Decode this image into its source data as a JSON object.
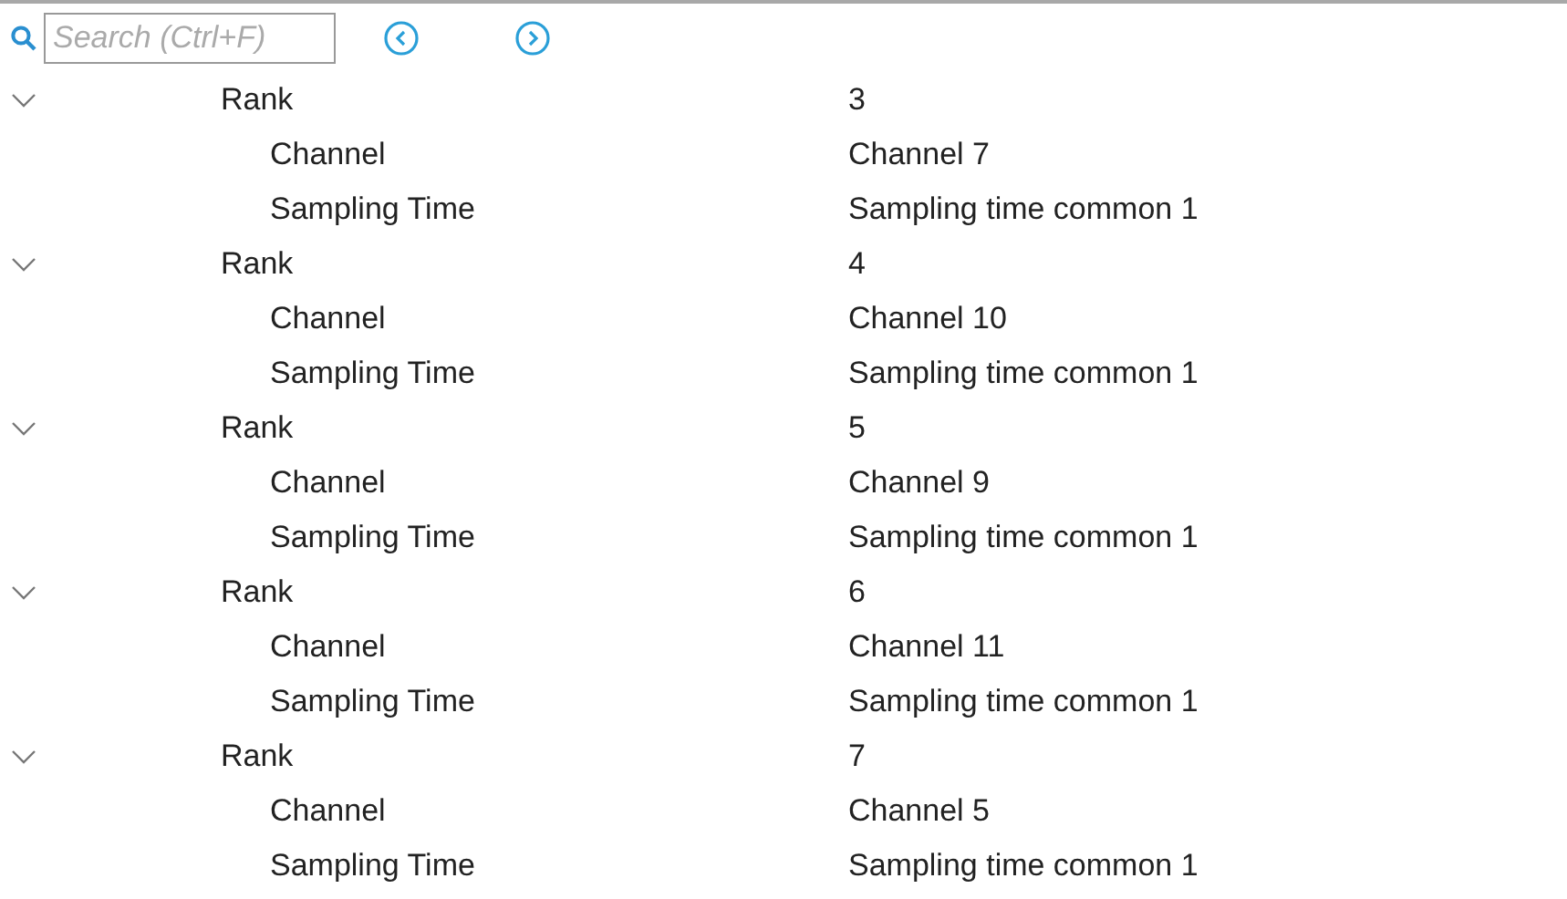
{
  "search": {
    "placeholder": "Search (Ctrl+F)"
  },
  "tree": [
    {
      "label": "Rank",
      "value": "3",
      "expanded": true,
      "children": [
        {
          "label": "Channel",
          "value": "Channel 7"
        },
        {
          "label": "Sampling Time",
          "value": "Sampling time common 1"
        }
      ]
    },
    {
      "label": "Rank",
      "value": "4",
      "expanded": true,
      "children": [
        {
          "label": "Channel",
          "value": "Channel 10"
        },
        {
          "label": "Sampling Time",
          "value": "Sampling time common 1"
        }
      ]
    },
    {
      "label": "Rank",
      "value": "5",
      "expanded": true,
      "children": [
        {
          "label": "Channel",
          "value": "Channel 9"
        },
        {
          "label": "Sampling Time",
          "value": "Sampling time common 1"
        }
      ]
    },
    {
      "label": "Rank",
      "value": "6",
      "expanded": true,
      "children": [
        {
          "label": "Channel",
          "value": "Channel 11"
        },
        {
          "label": "Sampling Time",
          "value": "Sampling time common 1"
        }
      ]
    },
    {
      "label": "Rank",
      "value": "7",
      "expanded": true,
      "children": [
        {
          "label": "Channel",
          "value": "Channel 5"
        },
        {
          "label": "Sampling Time",
          "value": "Sampling time common 1"
        }
      ]
    }
  ]
}
